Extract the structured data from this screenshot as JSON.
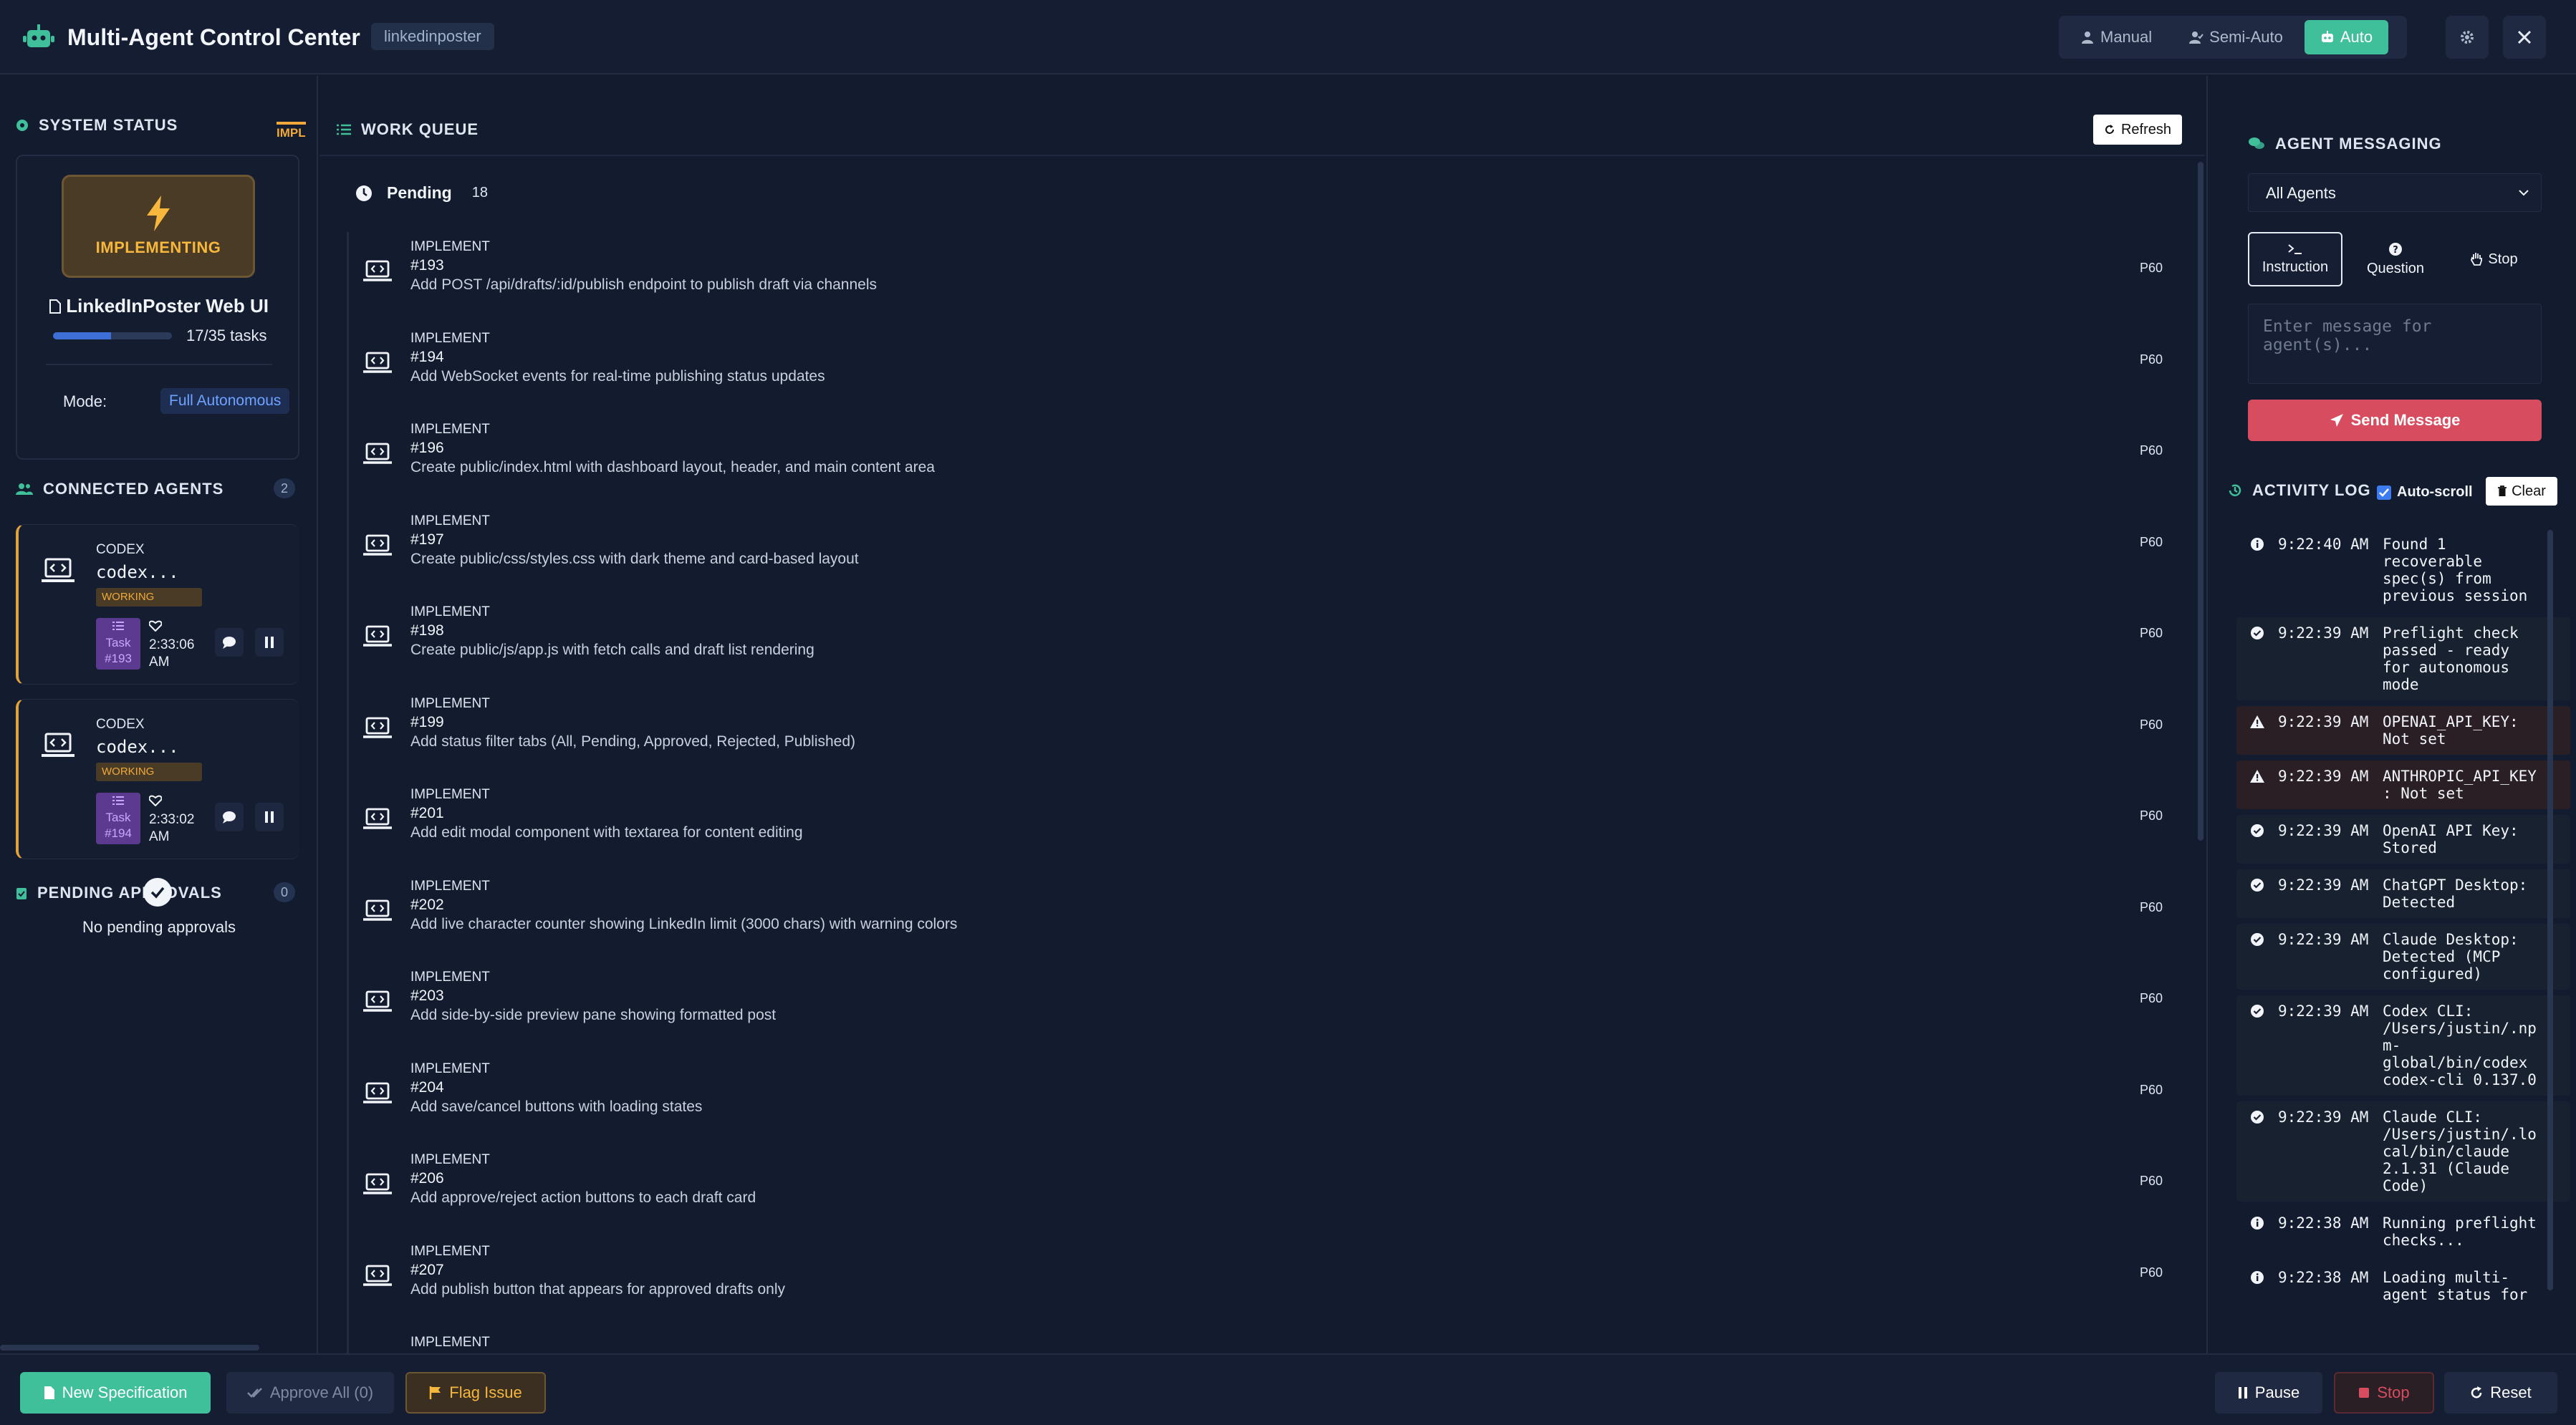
{
  "header": {
    "app_title": "Multi-Agent Control Center",
    "project_badge": "linkedinposter",
    "modes": [
      {
        "label": "Manual",
        "icon": "user-icon",
        "active": false
      },
      {
        "label": "Semi-Auto",
        "icon": "user-check-icon",
        "active": false
      },
      {
        "label": "Auto",
        "icon": "robot-icon",
        "active": true
      }
    ],
    "accent_color": "#3fbf9a"
  },
  "system_status": {
    "title": "SYSTEM STATUS",
    "tab_label": "IMPL",
    "phase": "IMPLEMENTING",
    "project_name": "LinkedInPoster Web UI",
    "progress_text": "17/35 tasks",
    "progress_fraction": 0.486,
    "mode_label": "Mode:",
    "mode_value": "Full Autonomous"
  },
  "connected_agents": {
    "title": "CONNECTED AGENTS",
    "count": "2",
    "agents": [
      {
        "type": "CODEX",
        "name": "codex...",
        "status": "WORKING",
        "task": "Task\n#193",
        "time": "2:33:06 AM"
      },
      {
        "type": "CODEX",
        "name": "codex...",
        "status": "WORKING",
        "task": "Task\n#194",
        "time": "2:33:02 AM"
      }
    ]
  },
  "pending_approvals": {
    "title": "PENDING APPROVALS",
    "count": "0",
    "empty_text": "No pending approvals"
  },
  "work_queue": {
    "title": "WORK QUEUE",
    "refresh_label": "Refresh",
    "pending_label": "Pending",
    "pending_count": "18",
    "items": [
      {
        "type": "IMPLEMENT",
        "id": "#193",
        "desc": "Add POST /api/drafts/:id/publish endpoint to publish draft via channels",
        "priority": "P60"
      },
      {
        "type": "IMPLEMENT",
        "id": "#194",
        "desc": "Add WebSocket events for real-time publishing status updates",
        "priority": "P60"
      },
      {
        "type": "IMPLEMENT",
        "id": "#196",
        "desc": "Create public/index.html with dashboard layout, header, and main content area",
        "priority": "P60"
      },
      {
        "type": "IMPLEMENT",
        "id": "#197",
        "desc": "Create public/css/styles.css with dark theme and card-based layout",
        "priority": "P60"
      },
      {
        "type": "IMPLEMENT",
        "id": "#198",
        "desc": "Create public/js/app.js with fetch calls and draft list rendering",
        "priority": "P60"
      },
      {
        "type": "IMPLEMENT",
        "id": "#199",
        "desc": "Add status filter tabs (All, Pending, Approved, Rejected, Published)",
        "priority": "P60"
      },
      {
        "type": "IMPLEMENT",
        "id": "#201",
        "desc": "Add edit modal component with textarea for content editing",
        "priority": "P60"
      },
      {
        "type": "IMPLEMENT",
        "id": "#202",
        "desc": "Add live character counter showing LinkedIn limit (3000 chars) with warning colors",
        "priority": "P60"
      },
      {
        "type": "IMPLEMENT",
        "id": "#203",
        "desc": "Add side-by-side preview pane showing formatted post",
        "priority": "P60"
      },
      {
        "type": "IMPLEMENT",
        "id": "#204",
        "desc": "Add save/cancel buttons with loading states",
        "priority": "P60"
      },
      {
        "type": "IMPLEMENT",
        "id": "#206",
        "desc": "Add approve/reject action buttons to each draft card",
        "priority": "P60"
      },
      {
        "type": "IMPLEMENT",
        "id": "#207",
        "desc": "Add publish button that appears for approved drafts only",
        "priority": "P60"
      },
      {
        "type": "IMPLEMENT",
        "id": "",
        "desc": "",
        "priority": ""
      }
    ]
  },
  "agent_messaging": {
    "title": "AGENT MESSAGING",
    "selected_target": "All Agents",
    "message_types": [
      {
        "label": "Instruction",
        "icon": "terminal-icon",
        "active": true
      },
      {
        "label": "Question",
        "icon": "question-icon",
        "active": false
      },
      {
        "label": "Stop",
        "icon": "hand-icon",
        "active": false
      }
    ],
    "placeholder": "Enter message for agent(s)...",
    "send_label": "Send Message"
  },
  "activity_log": {
    "title": "ACTIVITY LOG",
    "autoscroll_label": "Auto-scroll",
    "clear_label": "Clear",
    "entries": [
      {
        "kind": "info",
        "time": "9:22:40 AM",
        "msg": "Found 1\nrecoverable\nspec(s) from\nprevious session"
      },
      {
        "kind": "ok",
        "time": "9:22:39 AM",
        "msg": "Preflight check\npassed - ready\nfor autonomous\nmode"
      },
      {
        "kind": "warn",
        "time": "9:22:39 AM",
        "msg": "OPENAI_API_KEY:\nNot set"
      },
      {
        "kind": "warn",
        "time": "9:22:39 AM",
        "msg": "ANTHROPIC_API_KEY\n: Not set"
      },
      {
        "kind": "ok",
        "time": "9:22:39 AM",
        "msg": "OpenAI API Key:\nStored"
      },
      {
        "kind": "ok",
        "time": "9:22:39 AM",
        "msg": "ChatGPT Desktop:\nDetected"
      },
      {
        "kind": "ok",
        "time": "9:22:39 AM",
        "msg": "Claude Desktop:\nDetected (MCP\nconfigured)"
      },
      {
        "kind": "ok",
        "time": "9:22:39 AM",
        "msg": "Codex CLI:\n/Users/justin/.np\nm-\nglobal/bin/codex\ncodex-cli 0.137.0"
      },
      {
        "kind": "ok",
        "time": "9:22:39 AM",
        "msg": "Claude CLI:\n/Users/justin/.lo\ncal/bin/claude\n2.1.31 (Claude\nCode)"
      },
      {
        "kind": "info",
        "time": "9:22:38 AM",
        "msg": "Running preflight\nchecks..."
      },
      {
        "kind": "info",
        "time": "9:22:38 AM",
        "msg": "Loading multi-\nagent status for"
      }
    ]
  },
  "footer": {
    "new_spec_label": "New Specification",
    "approve_all_label": "Approve All (0)",
    "flag_issue_label": "Flag Issue",
    "pause_label": "Pause",
    "stop_label": "Stop",
    "reset_label": "Reset"
  }
}
